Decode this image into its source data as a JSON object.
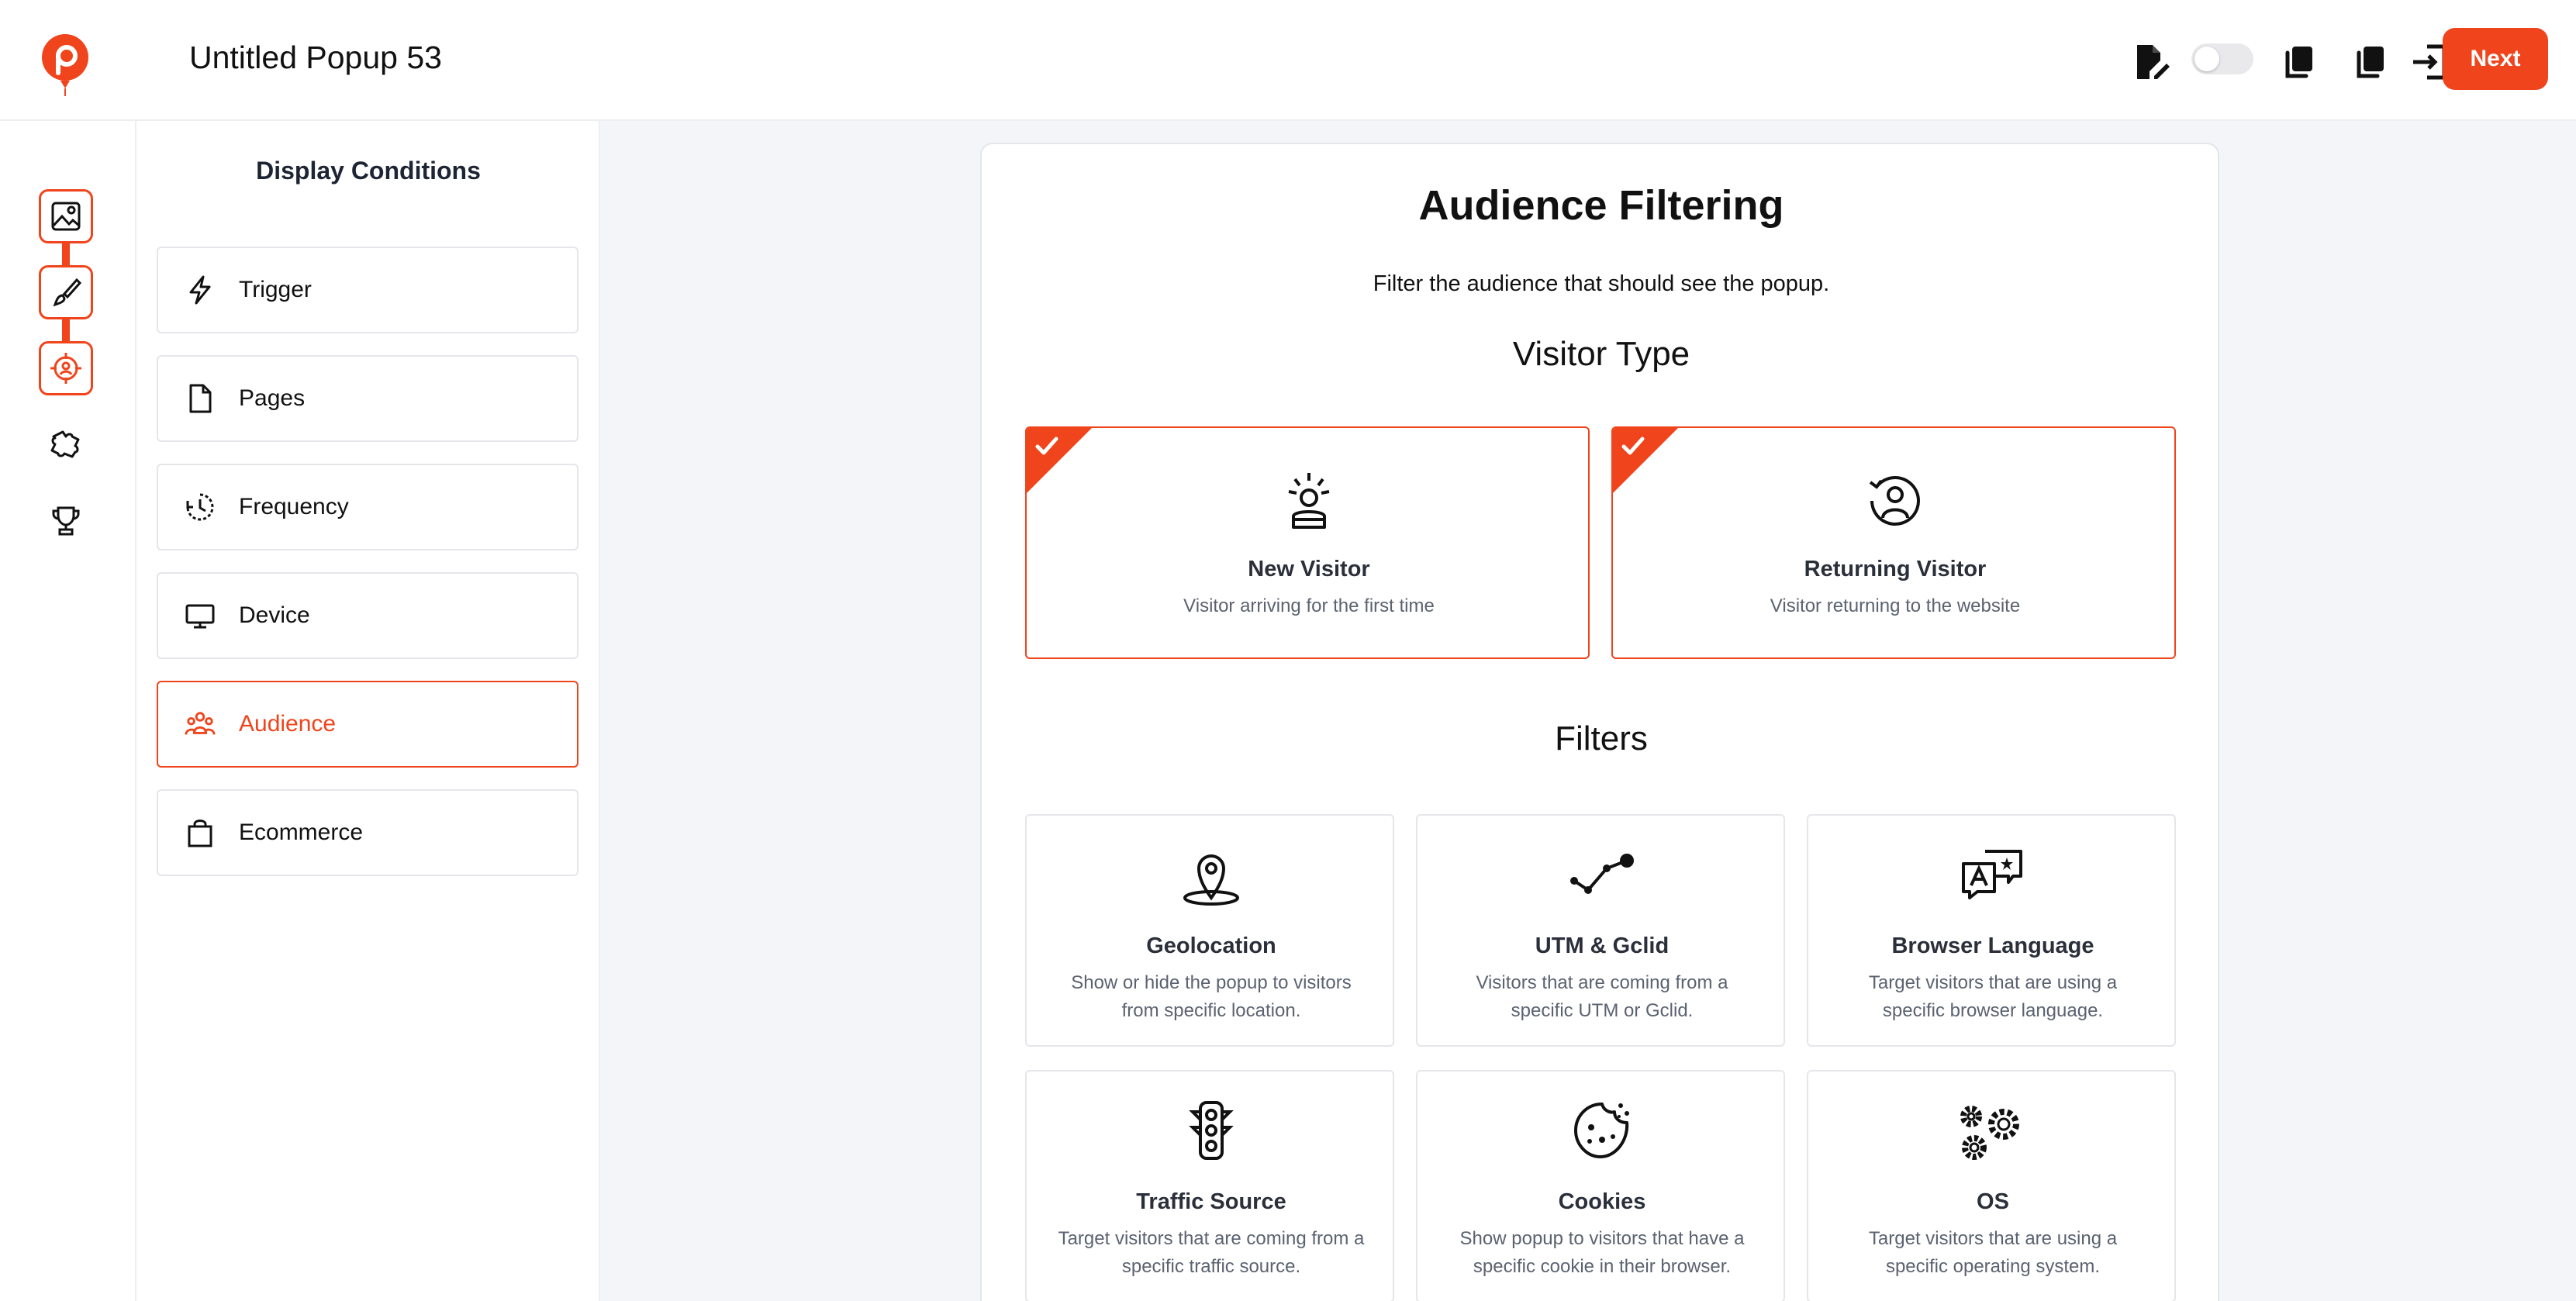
{
  "header": {
    "title": "Untitled Popup 53",
    "next_label": "Next",
    "icons": [
      "edit-document-icon",
      "toggle-switch",
      "copy-icon",
      "duplicate-icon",
      "sign-in-icon"
    ],
    "toggle_on": false
  },
  "rail": {
    "items": [
      "image-icon",
      "brush-icon",
      "target-icon",
      "puzzle-icon",
      "trophy-icon"
    ]
  },
  "sidebar": {
    "title": "Display Conditions",
    "items": [
      {
        "label": "Trigger",
        "icon": "lightning-icon"
      },
      {
        "label": "Pages",
        "icon": "page-icon"
      },
      {
        "label": "Frequency",
        "icon": "frequency-clock-icon"
      },
      {
        "label": "Device",
        "icon": "monitor-icon"
      },
      {
        "label": "Audience",
        "icon": "audience-icon",
        "active": true
      },
      {
        "label": "Ecommerce",
        "icon": "shopping-bag-icon"
      }
    ]
  },
  "main": {
    "title": "Audience Filtering",
    "subtitle": "Filter the audience that should see the popup.",
    "visitor_type_heading": "Visitor Type",
    "visitor_types": [
      {
        "name": "New Visitor",
        "desc": "Visitor arriving for the first time",
        "selected": true
      },
      {
        "name": "Returning Visitor",
        "desc": "Visitor returning to the website",
        "selected": true
      }
    ],
    "filters_heading": "Filters",
    "filters": [
      {
        "name": "Geolocation",
        "desc": "Show or hide the popup to visitors from specific location."
      },
      {
        "name": "UTM & Gclid",
        "desc": "Visitors that are coming from a specific UTM or Gclid."
      },
      {
        "name": "Browser Language",
        "desc": "Target visitors that are using a specific browser language."
      },
      {
        "name": "Traffic Source",
        "desc": "Target visitors that are coming from a specific traffic source."
      },
      {
        "name": "Cookies",
        "desc": "Show popup to visitors that have a specific cookie in their browser."
      },
      {
        "name": "OS",
        "desc": "Target visitors that are using a specific operating system."
      }
    ]
  },
  "colors": {
    "accent": "#f0441c",
    "background": "#f4f5f8",
    "border": "#e4e6ea"
  }
}
